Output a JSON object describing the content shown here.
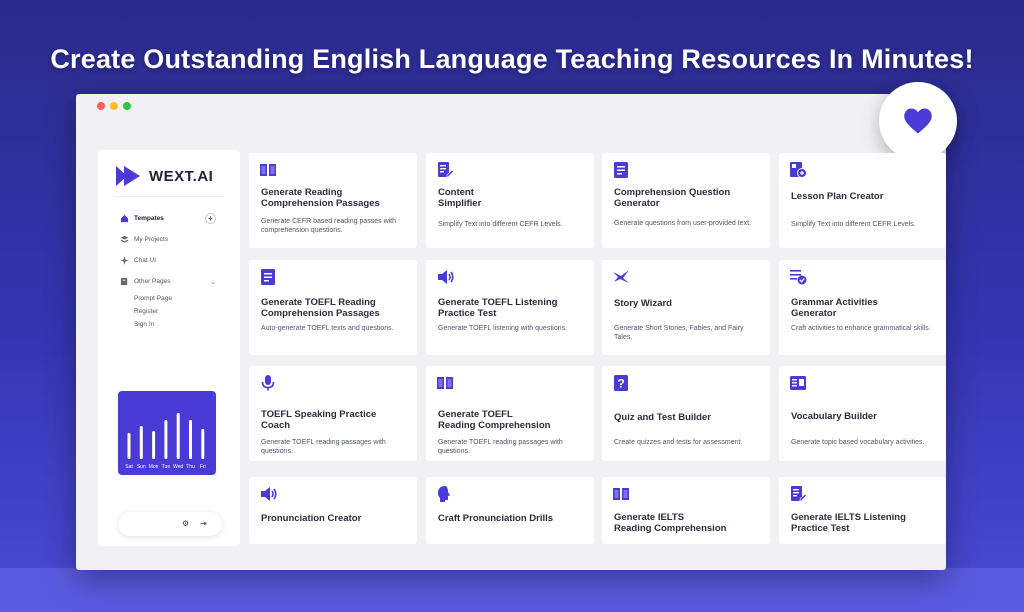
{
  "headline": "Create Outstanding English Language Teaching Resources In Minutes!",
  "colors": {
    "accent": "#4b3bd6",
    "background": "#2f2fa0"
  },
  "window_dots": [
    "#ff5f57",
    "#febc2e",
    "#28c840"
  ],
  "sidebar": {
    "brand": "WEXT.AI",
    "nav": [
      {
        "label": "Tempates",
        "icon": "home-icon",
        "active": true
      },
      {
        "label": "My Projects",
        "icon": "layers-icon"
      },
      {
        "label": "Chat UI",
        "icon": "sparkle-icon"
      },
      {
        "label": "Other Pages",
        "icon": "pages-icon"
      }
    ],
    "sub_items": [
      "Prompt Page",
      "Register",
      "Sign In"
    ],
    "chart_days": [
      "Sat",
      "Sun",
      "Mon",
      "Tue",
      "Wed",
      "Thu",
      "Fri"
    ]
  },
  "cards": [
    {
      "title": "Generate Reading\nComprehension Passages",
      "desc": "Generate CEFR based reading passes with comprehension questions.",
      "icon": "book-icon"
    },
    {
      "title": "Content\nSimplifier",
      "desc": "Simplify Text into different CEFR Levels.",
      "icon": "edit-doc-icon"
    },
    {
      "title": "Comprehension Question\nGenerator",
      "desc": "Generate questions from user-provided text.",
      "icon": "document-icon"
    },
    {
      "title": "Lesson Plan Creator",
      "desc": "Simplify Text into different CEFR Levels.",
      "icon": "plan-icon"
    },
    {
      "title": "Generate TOEFL Reading\nComprehension Passages",
      "desc": "Auto-generate TOEFL texts and questions.",
      "icon": "document-icon"
    },
    {
      "title": "Generate TOEFL Listening\nPractice Test",
      "desc": "Generate TOEFL listening with questions.",
      "icon": "speaker-icon"
    },
    {
      "title": "Story Wizard",
      "desc": "Generate Short Stories, Fables, and Fairy Tales.",
      "icon": "wand-icon"
    },
    {
      "title": "Grammar Activities\nGenerator",
      "desc": "Craft activities to enhance grammatical skills.",
      "icon": "checklist-icon"
    },
    {
      "title": "TOEFL Speaking Practice\nCoach",
      "desc": "Generate TOEFL reading passages with questions.",
      "icon": "microphone-icon"
    },
    {
      "title": "Generate TOEFL\nReading Comprehension",
      "desc": "Generate TOEFL reading passages with questions.",
      "icon": "book-icon"
    },
    {
      "title": "Quiz and Test Builder",
      "desc": "Create quizzes and tests for assessment.",
      "icon": "question-icon"
    },
    {
      "title": "Vocabulary Builder",
      "desc": "Generate topic based vocabulary activities.",
      "icon": "vocab-icon"
    },
    {
      "title": "Pronunciation Creator",
      "desc": "",
      "icon": "speaker-icon"
    },
    {
      "title": "Craft Pronunciation Drills",
      "desc": "",
      "icon": "head-speak-icon"
    },
    {
      "title": "Generate IELTS\nReading Comprehension",
      "desc": "",
      "icon": "book-icon"
    },
    {
      "title": "Generate IELTS Listening\nPractice Test",
      "desc": "",
      "icon": "edit-doc-icon"
    }
  ]
}
